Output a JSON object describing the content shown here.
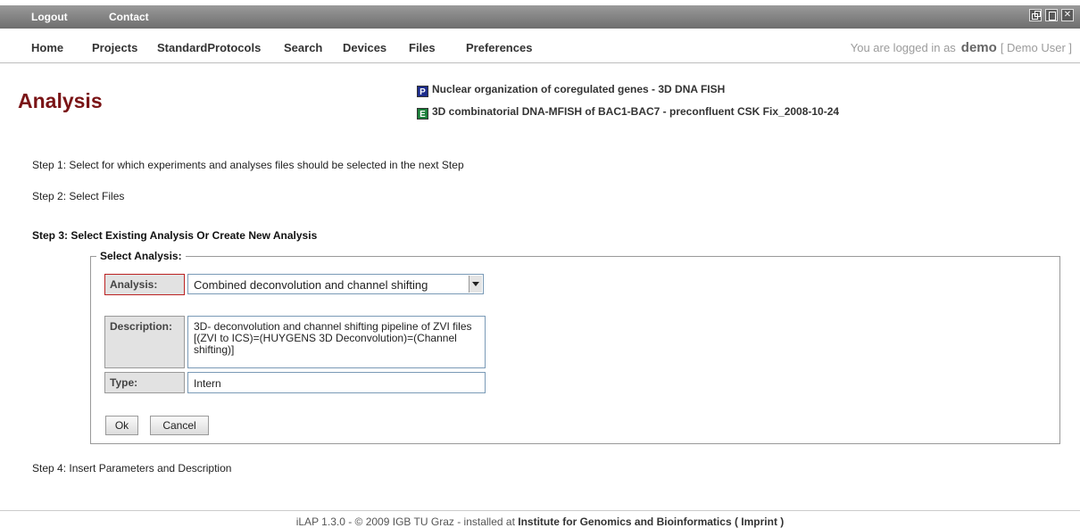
{
  "topbar": {
    "logout": "Logout",
    "contact": "Contact"
  },
  "nav": {
    "items": [
      "Home",
      "Projects",
      "StandardProtocols",
      "Search",
      "Devices",
      "Files",
      "Preferences"
    ],
    "login_prefix": "You are logged in as",
    "username": "demo",
    "fullname": "[ Demo User ]"
  },
  "page": {
    "title": "Analysis"
  },
  "context": {
    "project": {
      "badge": "P",
      "label": "Nuclear organization of coregulated genes - 3D DNA FISH"
    },
    "experiment": {
      "badge": "E",
      "label": "3D combinatorial DNA-MFISH of BAC1-BAC7 - preconfluent CSK Fix_2008-10-24"
    }
  },
  "steps": {
    "step1": "Step 1: Select for which experiments and analyses files should be selected in the next Step",
    "step2": "Step 2: Select Files",
    "step3": "Step 3: Select Existing Analysis Or Create New Analysis",
    "step4": "Step 4: Insert Parameters and Description"
  },
  "form": {
    "legend": "Select Analysis:",
    "analysis_label": "Analysis:",
    "analysis_value": "Combined deconvolution and channel shifting",
    "description_label": "Description:",
    "description_value": "3D- deconvolution and channel shifting pipeline of ZVI files [(ZVI to ICS)=(HUYGENS 3D Deconvolution)=(Channel shifting)]",
    "type_label": "Type:",
    "type_value": "Intern",
    "ok_label": "Ok",
    "cancel_label": "Cancel"
  },
  "footer": {
    "text": "iLAP 1.3.0 - © 2009 IGB TU Graz - installed at",
    "institute": "Institute for Genomics and Bioinformatics ( Imprint )"
  }
}
